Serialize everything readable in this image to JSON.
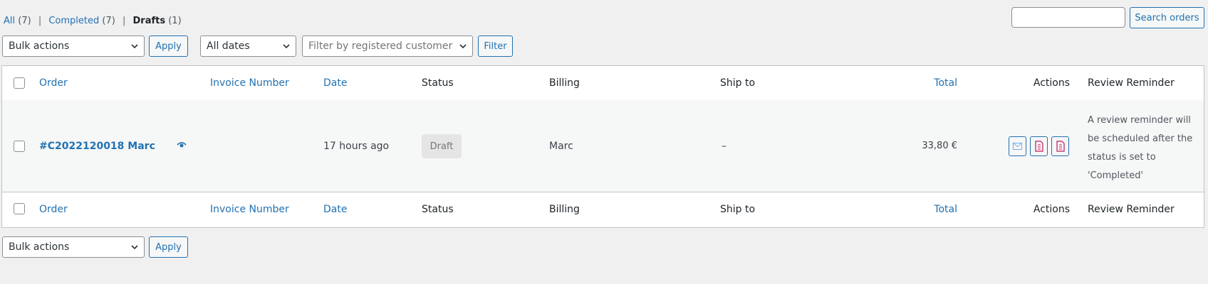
{
  "subnav": {
    "all_label": "All",
    "all_count": "(7)",
    "completed_label": "Completed",
    "completed_count": "(7)",
    "drafts_label": "Drafts",
    "drafts_count": "(1)",
    "separator": "|"
  },
  "search": {
    "value": "",
    "button": "Search orders"
  },
  "top_controls": {
    "bulk_actions": "Bulk actions",
    "apply": "Apply",
    "dates": "All dates",
    "customer_placeholder": "Filter by registered customer",
    "filter": "Filter"
  },
  "columns": {
    "order": "Order",
    "invoice": "Invoice Number",
    "date": "Date",
    "status": "Status",
    "billing": "Billing",
    "ship_to": "Ship to",
    "total": "Total",
    "actions": "Actions",
    "review": "Review Reminder"
  },
  "order_row": {
    "order": "#C2022120018 Marc",
    "invoice": "",
    "date": "17 hours ago",
    "status": "Draft",
    "billing": "Marc",
    "ship_to": "–",
    "total": "33,80 €",
    "review_text": "A review reminder will be scheduled after the status is set to 'Completed'",
    "action_icons": [
      "email-icon",
      "pdf-document-icon",
      "pdf-document-icon"
    ]
  },
  "bottom_controls": {
    "bulk_actions": "Bulk actions",
    "apply": "Apply"
  },
  "colors": {
    "link": "#2271b1",
    "background": "#f0f0f1",
    "pdf_accent": "#c2185b"
  }
}
